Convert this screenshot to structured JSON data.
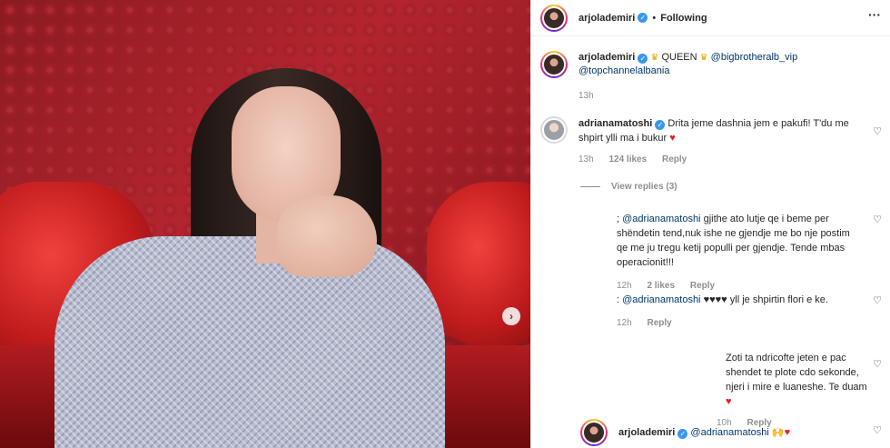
{
  "post": {
    "author": "arjolademiri",
    "follow_state": "Following",
    "separator": "•",
    "caption_label": "QUEEN",
    "caption_mention_1": "@bigbrotheralb_vip",
    "caption_mention_2": "@topchannelalbania",
    "caption_time": "13h"
  },
  "comments": [
    {
      "user": "adrianamatoshi",
      "text": "Drita jeme dashnia jem e pakufi! T'du me shpirt ylli ma i bukur",
      "time": "13h",
      "likes": "124 likes",
      "reply": "Reply",
      "view_replies": "View replies (3)"
    }
  ],
  "replies": [
    {
      "prefix": ";",
      "mention": "@adrianamatoshi",
      "text": "gjithe ato lutje qe i beme per shëndetin tend,nuk ishe ne gjendje me bo nje postim qe me ju tregu ketij populli per gjendje. Tende mbas operacionit!!!",
      "time": "12h",
      "likes": "2 likes",
      "reply": "Reply"
    },
    {
      "prefix": ":",
      "mention": "@adrianamatoshi",
      "hearts": "♥♥♥♥",
      "text": "yll je shpirtin flori e ke.",
      "time": "12h",
      "reply": "Reply"
    },
    {
      "text": "Zoti ta ndricofte jeten e pac shendet te plote cdo sekonde, njeri i mire e luaneshe. Te duam",
      "time": "10h",
      "reply": "Reply"
    },
    {
      "user": "arjolademiri",
      "mention": "@adrianamatoshi",
      "emoji": "🙌"
    }
  ],
  "icons": {
    "verified": "verified-badge",
    "more": "more-options-icon",
    "like": "heart-outline-icon",
    "next": "chevron-right-icon"
  },
  "colors": {
    "link": "#00376b",
    "meta": "#8e8e8e",
    "verified": "#3897f0",
    "heart": "#ed1c24"
  }
}
